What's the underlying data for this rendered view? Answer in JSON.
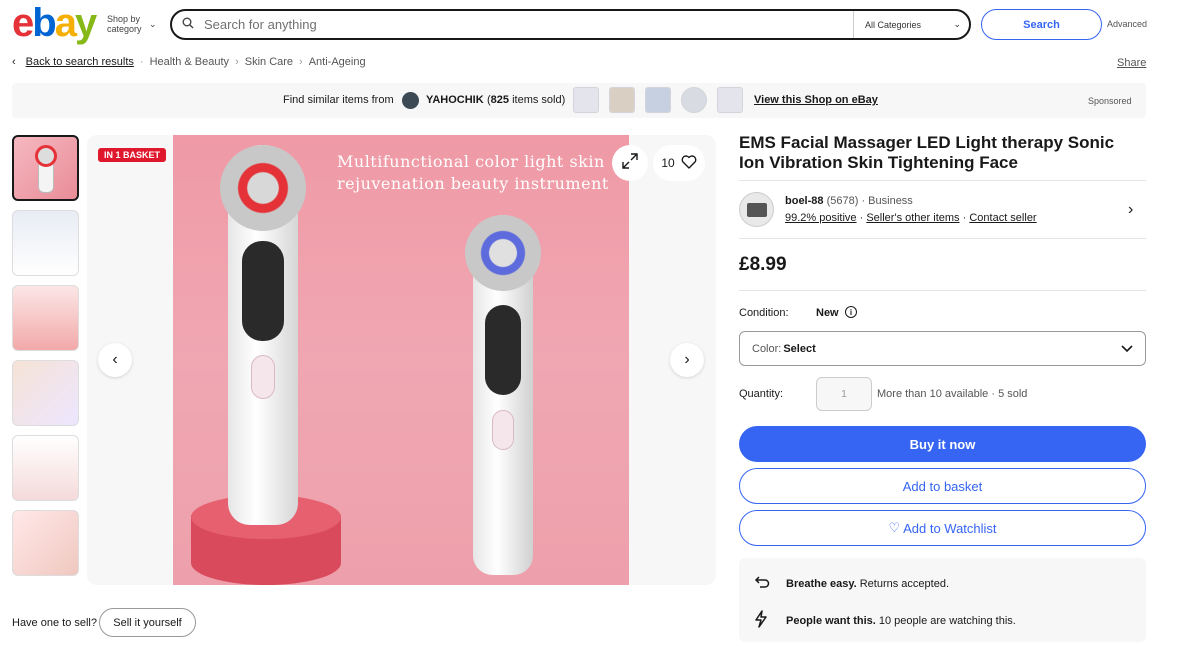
{
  "header": {
    "logo": {
      "e": "e",
      "b": "b",
      "a": "a",
      "y": "y"
    },
    "shop_by_line1": "Shop by",
    "shop_by_line2": "category",
    "search_placeholder": "Search for anything",
    "category_select": "All Categories",
    "search_button": "Search",
    "advanced": "Advanced"
  },
  "breadcrumb": {
    "back": "Back to search results",
    "items": [
      "Health & Beauty",
      "Skin Care",
      "Anti-Ageing"
    ],
    "share": "Share"
  },
  "banner": {
    "find_text": "Find similar items from",
    "shop_name": "YAHOCHIK",
    "shop_count_prefix": "(",
    "shop_count": "825",
    "shop_count_suffix": " items sold)",
    "view_shop": "View this Shop on eBay",
    "sponsored": "Sponsored"
  },
  "gallery": {
    "badge": "IN 1 BASKET",
    "watch_count": "10",
    "photo_headline_1": "Multifunctional color light skin",
    "photo_headline_2": "rejuvenation beauty instrument"
  },
  "sell": {
    "question": "Have one to sell?",
    "button": "Sell it yourself"
  },
  "listing": {
    "title": "EMS Facial Massager LED Light therapy Sonic Ion Vibration Skin Tightening Face",
    "seller": {
      "name": "boel-88",
      "feedback_count": "(5678)",
      "type": "Business",
      "positive": "99.2% positive",
      "other_items": "Seller's other items",
      "contact": "Contact seller"
    },
    "price": "£8.99",
    "condition_label": "Condition:",
    "condition_value": "New",
    "color_label": "Color:",
    "color_value": "Select",
    "quantity_label": "Quantity:",
    "quantity_value": "1",
    "availability": "More than 10 available · 5 sold",
    "buy_now": "Buy it now",
    "add_basket": "Add to basket",
    "add_watchlist": "Add to Watchlist"
  },
  "promos": [
    {
      "bold": "Breathe easy.",
      "text": "Returns accepted."
    },
    {
      "bold": "People want this.",
      "text": "10 people are watching this."
    }
  ]
}
